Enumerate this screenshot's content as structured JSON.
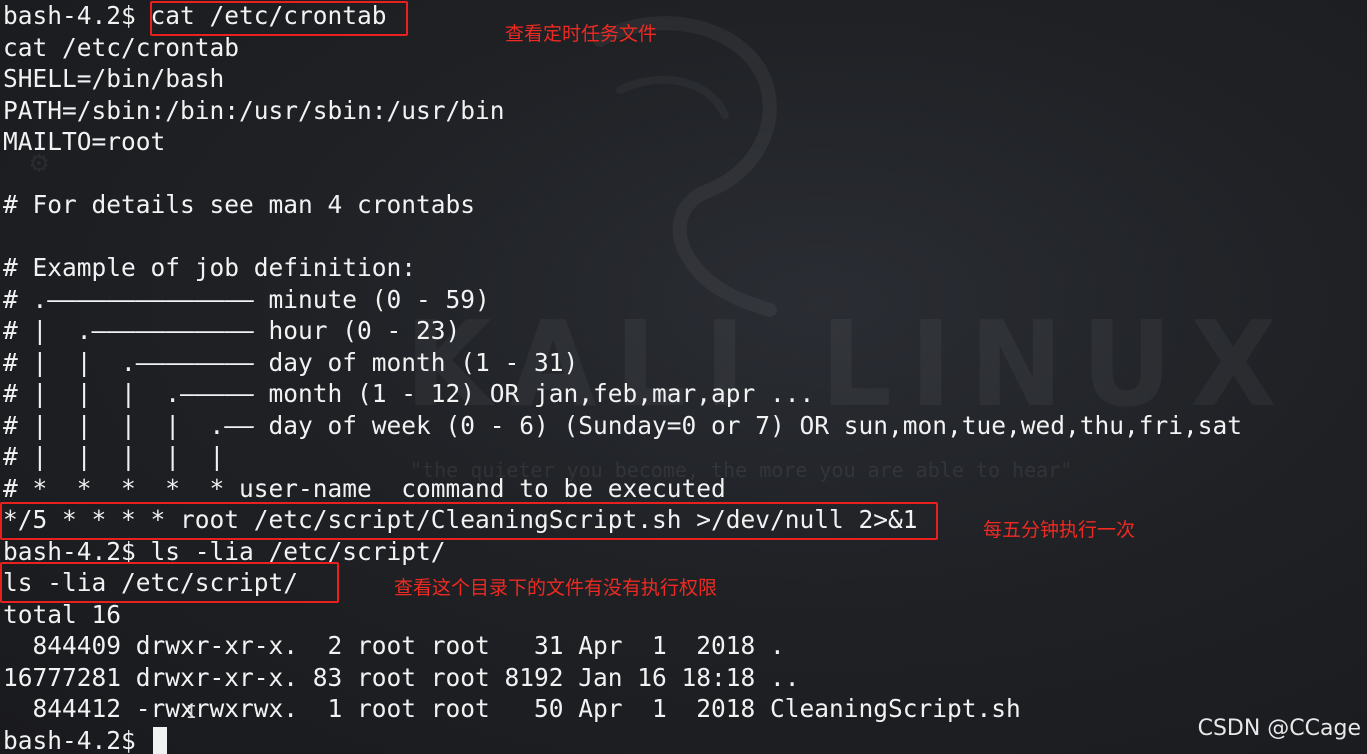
{
  "terminal": {
    "lines": [
      "bash-4.2$ cat /etc/crontab",
      "cat /etc/crontab",
      "SHELL=/bin/bash",
      "PATH=/sbin:/bin:/usr/sbin:/usr/bin",
      "MAILTO=root",
      "",
      "# For details see man 4 crontabs",
      "",
      "# Example of job definition:",
      "# .—————————————— minute (0 - 59)",
      "# |  .——————————— hour (0 - 23)",
      "# |  |  .———————— day of month (1 - 31)",
      "# |  |  |  .————— month (1 - 12) OR jan,feb,mar,apr ...",
      "# |  |  |  |  .—— day of week (0 - 6) (Sunday=0 or 7) OR sun,mon,tue,wed,thu,fri,sat",
      "# |  |  |  |  |",
      "# *  *  *  *  * user-name  command to be executed",
      "*/5 * * * * root /etc/script/CleaningScript.sh >/dev/null 2>&1",
      "bash-4.2$ ls -lia /etc/script/",
      "ls -lia /etc/script/",
      "total 16",
      "  844409 drwxr-xr-x.  2 root root   31 Apr  1  2018 .",
      "16777281 drwxr-xr-x. 83 root root 8192 Jan 16 18:18 ..",
      "  844412 -rwxrwxrwx.  1 root root   50 Apr  1  2018 CleaningScript.sh",
      "bash-4.2$ "
    ]
  },
  "annotations": {
    "note_crontab": "查看定时任务文件",
    "note_every_five_minutes": "每五分钟执行一次",
    "note_check_permissions": "查看这个目录下的文件有没有执行权限",
    "colors": {
      "annotation_red": "#e8201e",
      "terminal_text": "#f2f2f2",
      "background": "#1c1e22"
    }
  },
  "wallpaper": {
    "logo_text": "KALI LINUX",
    "quote": "\"the quieter you become, the more you are able to hear\""
  },
  "watermark": "CSDN @CCage"
}
